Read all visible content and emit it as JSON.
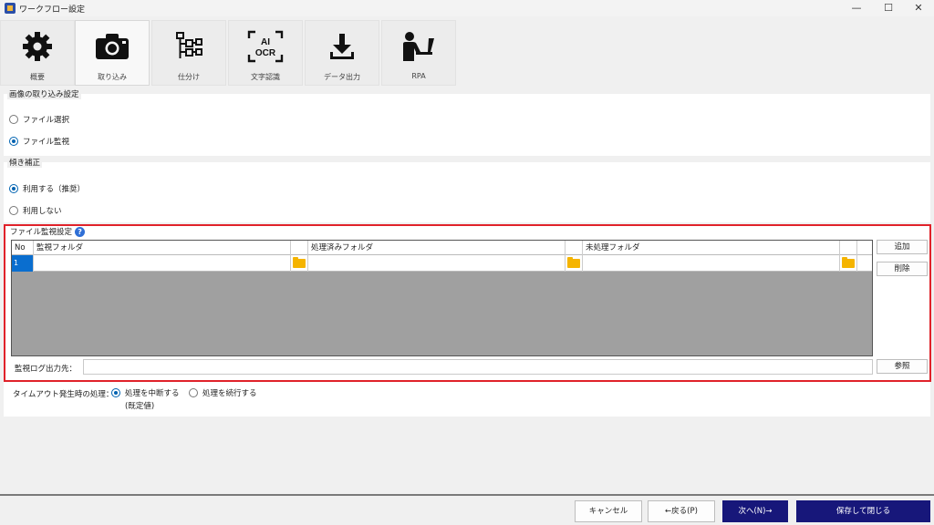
{
  "window": {
    "title": "ワークフロー設定",
    "minimize": "—",
    "maximize": "☐",
    "close": "✕"
  },
  "tabs": [
    {
      "label": "概要",
      "icon": "gear-icon"
    },
    {
      "label": "取り込み",
      "icon": "camera-icon"
    },
    {
      "label": "仕分け",
      "icon": "tree-icon"
    },
    {
      "label": "文字認識",
      "icon": "ai-ocr-icon",
      "icon_text_top": "AI",
      "icon_text_bottom": "OCR"
    },
    {
      "label": "データ出力",
      "icon": "download-icon"
    },
    {
      "label": "RPA",
      "icon": "person-computer-icon"
    }
  ],
  "image_import": {
    "label": "画像の取り込み設定",
    "options": [
      "ファイル選択",
      "ファイル監視"
    ],
    "selected": "ファイル監視"
  },
  "skew": {
    "label": "傾き補正",
    "options": [
      "利用する（推奨）",
      "利用しない"
    ],
    "selected": "利用する（推奨）"
  },
  "monitor": {
    "label": "ファイル監視設定",
    "help": "?",
    "columns": [
      "No",
      "監視フォルダ",
      "処理済みフォルダ",
      "未処理フォルダ"
    ],
    "rows": [
      {
        "no": "1",
        "watch": "",
        "done": "",
        "undone": ""
      }
    ],
    "add_button": "追加",
    "delete_button": "削除",
    "log_label": "監視ログ出力先：",
    "log_value": "",
    "browse_button": "参照"
  },
  "timeout": {
    "label": "タイムアウト発生時の処理：",
    "options": [
      "処理を中断する",
      "処理を続行する"
    ],
    "default_note": "(既定値)",
    "selected": "処理を中断する"
  },
  "footer": {
    "cancel": "キャンセル",
    "back": "←戻る(P)",
    "next": "次へ(N)→",
    "save_close": "保存して閉じる"
  },
  "colors": {
    "accent": "#0063b1",
    "highlight_border": "#e0222a",
    "primary_button": "#17177a",
    "folder": "#f5b400"
  }
}
